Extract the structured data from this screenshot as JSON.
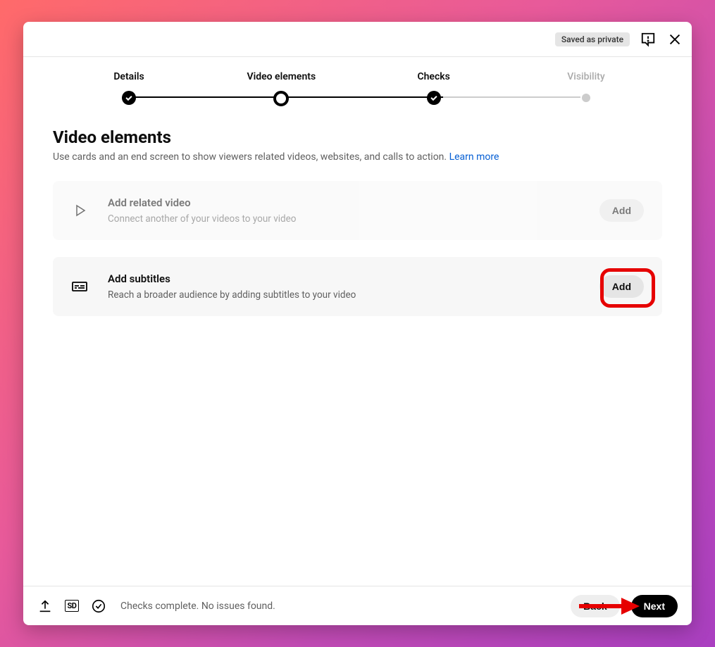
{
  "header": {
    "saved_badge": "Saved as private"
  },
  "stepper": {
    "steps": [
      {
        "label": "Details",
        "state": "done"
      },
      {
        "label": "Video elements",
        "state": "current"
      },
      {
        "label": "Checks",
        "state": "done"
      },
      {
        "label": "Visibility",
        "state": "inactive"
      }
    ]
  },
  "page": {
    "title": "Video elements",
    "description": "Use cards and an end screen to show viewers related videos, websites, and calls to action.",
    "learn_more": "Learn more"
  },
  "cards": {
    "related_video": {
      "title": "Add related video",
      "subtitle": "Connect another of your videos to your video",
      "button": "Add"
    },
    "subtitles": {
      "title": "Add subtitles",
      "subtitle": "Reach a broader audience by adding subtitles to your video",
      "button": "Add"
    }
  },
  "footer": {
    "sd_label": "SD",
    "status": "Checks complete. No issues found.",
    "back": "Back",
    "next": "Next"
  }
}
